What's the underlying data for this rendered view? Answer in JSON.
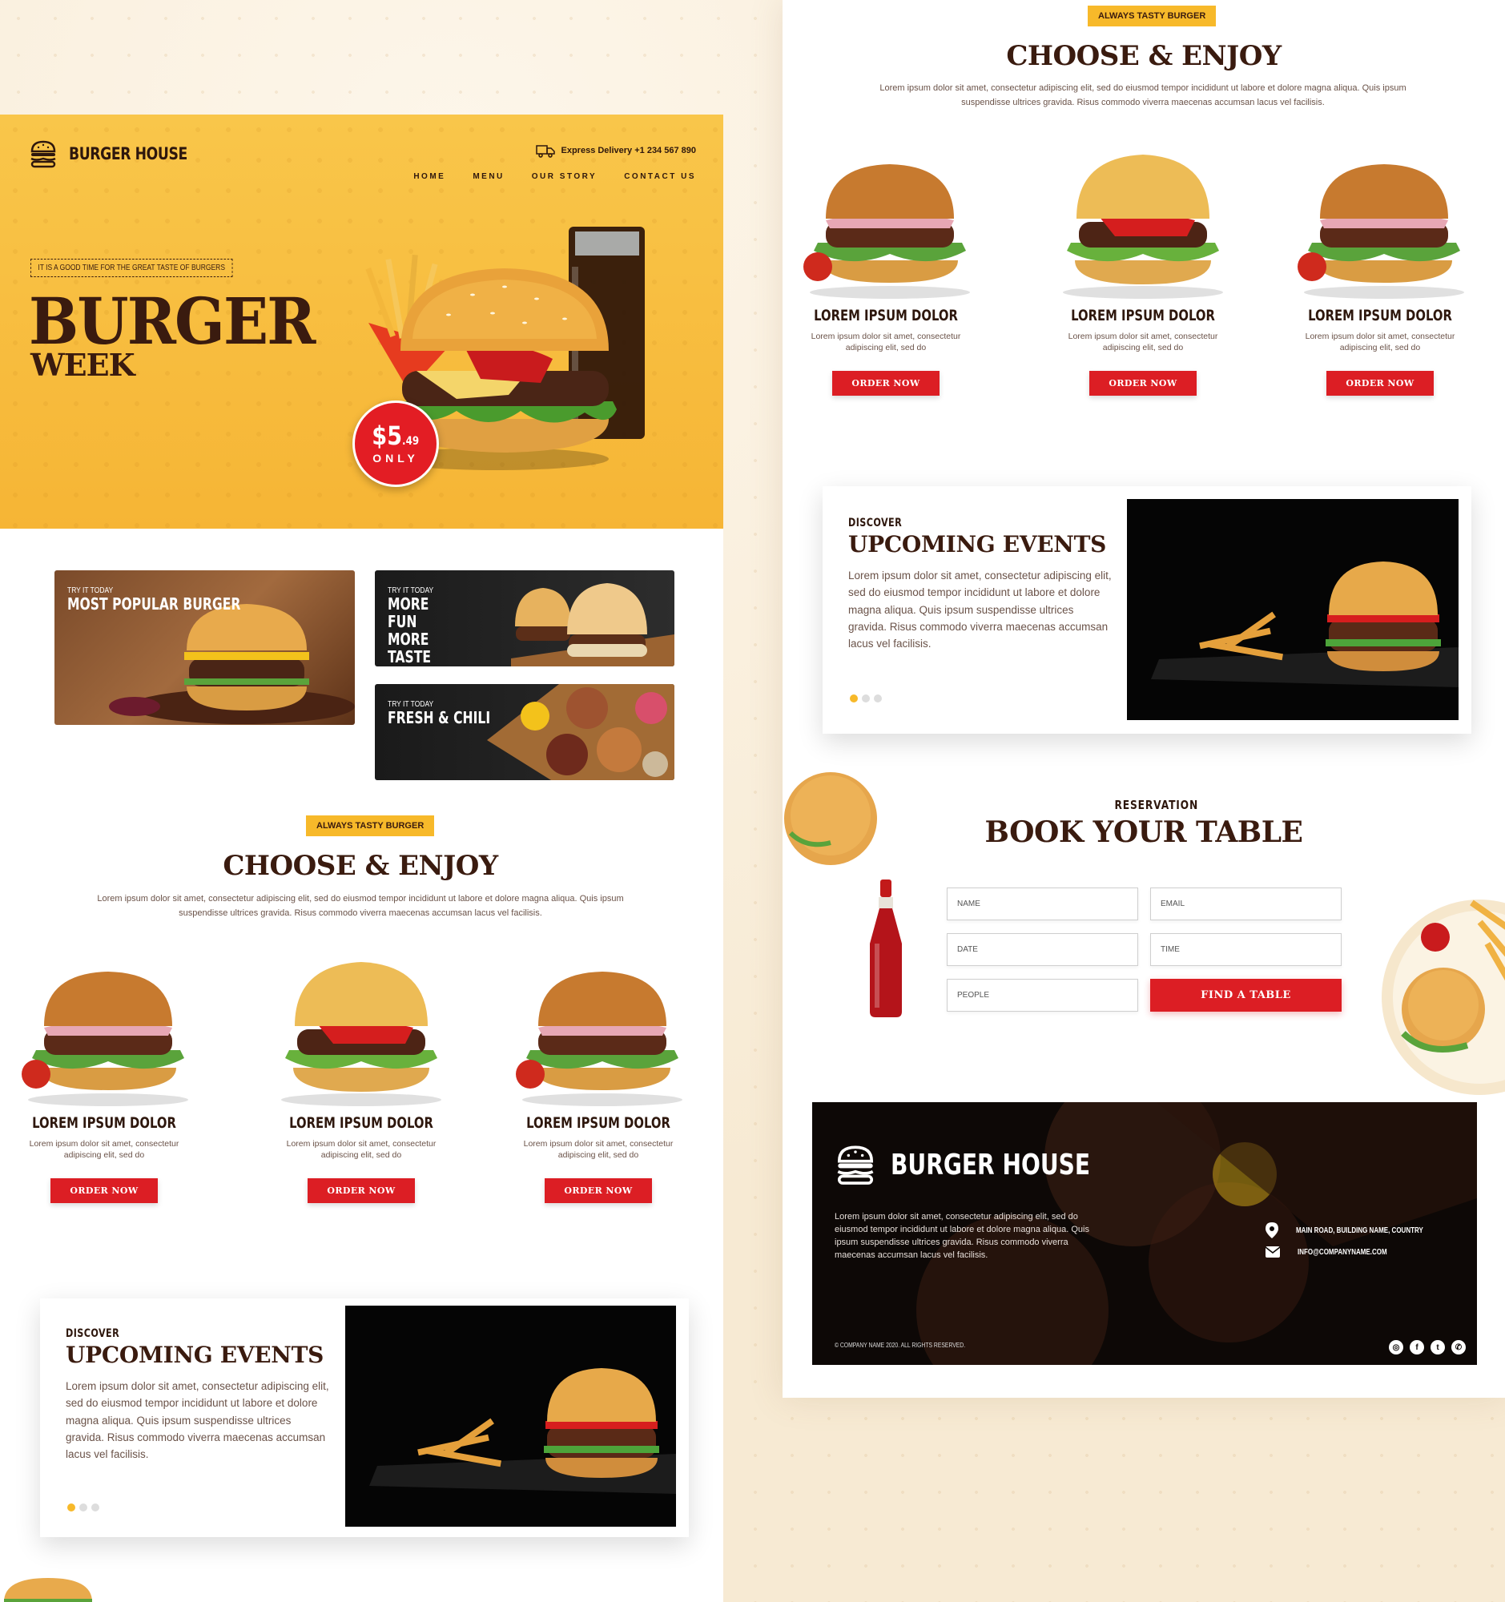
{
  "brand": {
    "name": "BURGER HOUSE",
    "delivery": "Express Delivery +1 234 567 890"
  },
  "nav": [
    "HOME",
    "MENU",
    "OUR STORY",
    "CONTACT US"
  ],
  "hero": {
    "tagline": "IT IS A GOOD TIME FOR THE GREAT TASTE OF BURGERS",
    "title": "BURGER",
    "subtitle": "WEEK",
    "price_main": "$5",
    "price_cents": ".49",
    "price_note": "ONLY"
  },
  "promos": [
    {
      "kicker": "TRY IT TODAY",
      "title": "MOST POPULAR BURGER"
    },
    {
      "kicker": "TRY IT TODAY",
      "title": "MORE FUN MORE TASTE"
    },
    {
      "kicker": "TRY IT TODAY",
      "title": "FRESH & CHILI"
    }
  ],
  "choose": {
    "badge": "ALWAYS TASTY BURGER",
    "title": "CHOOSE & ENJOY",
    "description": "Lorem ipsum dolor sit amet, consectetur adipiscing elit, sed do eiusmod tempor incididunt ut labore et dolore magna aliqua. Quis ipsum suspendisse ultrices gravida. Risus commodo viverra maecenas accumsan lacus vel facilisis."
  },
  "products": [
    {
      "name": "LOREM IPSUM DOLOR",
      "desc": "Lorem ipsum dolor sit amet, consectetur adipiscing elit, sed do",
      "button": "ORDER NOW"
    },
    {
      "name": "LOREM IPSUM DOLOR",
      "desc": "Lorem ipsum dolor sit amet, consectetur adipiscing elit, sed do",
      "button": "ORDER NOW"
    },
    {
      "name": "LOREM IPSUM DOLOR",
      "desc": "Lorem ipsum dolor sit amet, consectetur adipiscing elit, sed do",
      "button": "ORDER NOW"
    }
  ],
  "events": {
    "kicker": "DISCOVER",
    "title": "UPCOMING EVENTS",
    "text": "Lorem ipsum dolor sit amet, consectetur adipiscing elit, sed do eiusmod tempor incididunt ut labore et dolore magna aliqua. Quis ipsum suspendisse ultrices gravida. Risus commodo viverra maecenas accumsan lacus vel facilisis."
  },
  "reservation": {
    "kicker": "RESERVATION",
    "title": "BOOK YOUR TABLE",
    "fields": {
      "name": "NAME",
      "email": "EMAIL",
      "date": "DATE",
      "time": "TIME",
      "people": "PEOPLE"
    },
    "button": "FIND A TABLE"
  },
  "footer": {
    "brand": "BURGER HOUSE",
    "text": "Lorem ipsum dolor sit amet, consectetur adipiscing elit, sed do eiusmod tempor incididunt ut labore et dolore magna aliqua. Quis ipsum suspendisse ultrices gravida. Risus commodo viverra maecenas accumsan lacus vel facilisis.",
    "address": "MAIN ROAD, BUILDING NAME, COUNTRY",
    "email": "INFO@COMPANYNAME.COM",
    "copyright": "© COMPANY NAME 2020. ALL RIGHTS RESERVED.",
    "socials": [
      "instagram-icon",
      "facebook-icon",
      "twitter-icon",
      "whatsapp-icon"
    ]
  },
  "colors": {
    "accent_red": "#dc1e24",
    "accent_yellow": "#f7b92a",
    "brown": "#3a1b0f"
  }
}
